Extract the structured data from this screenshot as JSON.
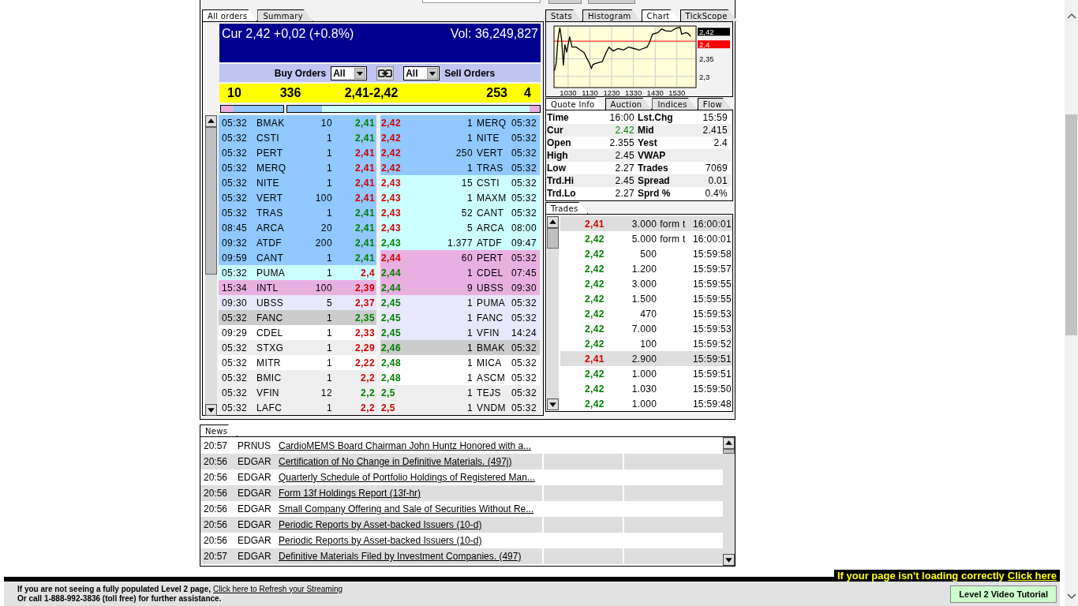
{
  "order_book": {
    "tabs": [
      {
        "label": "All orders",
        "selected": true
      },
      {
        "label": "Summary",
        "selected": false
      }
    ],
    "header": {
      "current": "Cur 2,42 +0,02 (+0.8%)",
      "volume": "Vol: 36,249,827"
    },
    "filters": {
      "buy_label": "Buy Orders",
      "buy_value": "All",
      "sell_value": "All",
      "sell_label": "Sell Orders"
    },
    "summary": [
      "10",
      "336",
      "2,41-2,42",
      "253",
      "4"
    ],
    "depth_bars": [
      {
        "color": "#90c8ff",
        "fills": [
          {
            "kind": "left",
            "color": "#e8b0e0",
            "level": 0.2
          }
        ]
      },
      {
        "color": "#ccffff",
        "fills": [
          {
            "kind": "left",
            "color": "#90c8ff",
            "level": 0.14
          },
          {
            "kind": "right",
            "color": "#e8b0e0",
            "level": 0.04
          }
        ]
      }
    ],
    "bids": [
      {
        "time": "05:32",
        "mmid": "BMAK",
        "size": "10",
        "price": "2,41",
        "up": true,
        "color": "#90c8ff"
      },
      {
        "time": "05:32",
        "mmid": "CSTI",
        "size": "1",
        "price": "2,41",
        "up": true,
        "color": "#90c8ff"
      },
      {
        "time": "05:32",
        "mmid": "PERT",
        "size": "1",
        "price": "2,41",
        "up": false,
        "color": "#90c8ff"
      },
      {
        "time": "05:32",
        "mmid": "MERQ",
        "size": "1",
        "price": "2,41",
        "up": false,
        "color": "#90c8ff"
      },
      {
        "time": "05:32",
        "mmid": "NITE",
        "size": "1",
        "price": "2,41",
        "up": false,
        "color": "#90c8ff"
      },
      {
        "time": "05:32",
        "mmid": "VERT",
        "size": "100",
        "price": "2,41",
        "up": false,
        "color": "#90c8ff"
      },
      {
        "time": "05:32",
        "mmid": "TRAS",
        "size": "1",
        "price": "2,41",
        "up": true,
        "color": "#90c8ff"
      },
      {
        "time": "08:45",
        "mmid": "ARCA",
        "size": "20",
        "price": "2,41",
        "up": true,
        "color": "#90c8ff"
      },
      {
        "time": "09:32",
        "mmid": "ATDF",
        "size": "200",
        "price": "2,41",
        "up": true,
        "color": "#90c8ff"
      },
      {
        "time": "09:59",
        "mmid": "CANT",
        "size": "1",
        "price": "2,41",
        "up": true,
        "color": "#90c8ff"
      },
      {
        "time": "05:32",
        "mmid": "PUMA",
        "size": "1",
        "price": "2,4",
        "up": false,
        "color": "#ccffff"
      },
      {
        "time": "15:34",
        "mmid": "INTL",
        "size": "100",
        "price": "2,39",
        "up": false,
        "color": "#e8b0e0"
      },
      {
        "time": "09:30",
        "mmid": "UBSS",
        "size": "5",
        "price": "2,37",
        "up": false,
        "color": "#e8e8fc"
      },
      {
        "time": "05:32",
        "mmid": "FANC",
        "size": "1",
        "price": "2,35",
        "up": true,
        "color": "#cccccc"
      },
      {
        "time": "09:29",
        "mmid": "CDEL",
        "size": "1",
        "price": "2,33",
        "up": false,
        "color": "#ffffff"
      },
      {
        "time": "05:32",
        "mmid": "STXG",
        "size": "1",
        "price": "2,29",
        "up": false,
        "color": "#eeeeee"
      },
      {
        "time": "05:32",
        "mmid": "MITR",
        "size": "1",
        "price": "2,22",
        "up": false,
        "color": "#ffffff"
      },
      {
        "time": "05:32",
        "mmid": "BMIC",
        "size": "1",
        "price": "2,2",
        "up": false,
        "color": "#eeeeee"
      },
      {
        "time": "05:32",
        "mmid": "VFIN",
        "size": "12",
        "price": "2,2",
        "up": true,
        "color": "#eeeeee"
      },
      {
        "time": "05:32",
        "mmid": "LAFC",
        "size": "1",
        "price": "2,2",
        "up": false,
        "color": "#eeeeee"
      }
    ],
    "asks": [
      {
        "price": "2,42",
        "size": "1",
        "mmid": "MERQ",
        "time": "05:32",
        "up": false,
        "color": "#90c8ff"
      },
      {
        "price": "2,42",
        "size": "1",
        "mmid": "NITE",
        "time": "05:32",
        "up": false,
        "color": "#90c8ff"
      },
      {
        "price": "2,42",
        "size": "250",
        "mmid": "VERT",
        "time": "05:32",
        "up": false,
        "color": "#90c8ff"
      },
      {
        "price": "2,42",
        "size": "1",
        "mmid": "TRAS",
        "time": "05:32",
        "up": false,
        "color": "#90c8ff"
      },
      {
        "price": "2,43",
        "size": "15",
        "mmid": "CSTI",
        "time": "05:32",
        "up": false,
        "color": "#ccffff"
      },
      {
        "price": "2,43",
        "size": "1",
        "mmid": "MAXM",
        "time": "05:32",
        "up": false,
        "color": "#ccffff"
      },
      {
        "price": "2,43",
        "size": "52",
        "mmid": "CANT",
        "time": "05:32",
        "up": false,
        "color": "#ccffff"
      },
      {
        "price": "2,43",
        "size": "5",
        "mmid": "ARCA",
        "time": "08:00",
        "up": false,
        "color": "#ccffff"
      },
      {
        "price": "2,43",
        "size": "1.377",
        "mmid": "ATDF",
        "time": "09:47",
        "up": true,
        "color": "#ccffff"
      },
      {
        "price": "2,44",
        "size": "60",
        "mmid": "PERT",
        "time": "05:32",
        "up": false,
        "color": "#e8b0e0"
      },
      {
        "price": "2,44",
        "size": "1",
        "mmid": "CDEL",
        "time": "07:45",
        "up": true,
        "color": "#e8b0e0"
      },
      {
        "price": "2,44",
        "size": "9",
        "mmid": "UBSS",
        "time": "09:30",
        "up": true,
        "color": "#e8b0e0"
      },
      {
        "price": "2,45",
        "size": "1",
        "mmid": "PUMA",
        "time": "05:32",
        "up": true,
        "color": "#e8e8fc"
      },
      {
        "price": "2,45",
        "size": "1",
        "mmid": "FANC",
        "time": "05:32",
        "up": true,
        "color": "#e8e8fc"
      },
      {
        "price": "2,45",
        "size": "1",
        "mmid": "VFIN",
        "time": "14:24",
        "up": true,
        "color": "#e8e8fc"
      },
      {
        "price": "2,46",
        "size": "1",
        "mmid": "BMAK",
        "time": "05:32",
        "up": true,
        "color": "#cccccc"
      },
      {
        "price": "2,48",
        "size": "1",
        "mmid": "MICA",
        "time": "05:32",
        "up": true,
        "color": "#ffffff"
      },
      {
        "price": "2,48",
        "size": "1",
        "mmid": "ASCM",
        "time": "05:32",
        "up": true,
        "color": "#ffffff"
      },
      {
        "price": "2,5",
        "size": "1",
        "mmid": "TEJS",
        "time": "05:32",
        "up": true,
        "color": "#eeeeee"
      },
      {
        "price": "2,5",
        "size": "1",
        "mmid": "VNDM",
        "time": "05:32",
        "up": false,
        "color": "#eeeeee"
      }
    ]
  },
  "chart_panel": {
    "tabs": [
      {
        "label": "Stats",
        "selected": false
      },
      {
        "label": "Histogram",
        "selected": false
      },
      {
        "label": "Chart",
        "selected": true
      },
      {
        "label": "TickScope",
        "selected": false
      }
    ],
    "price_markers": [
      {
        "color": "#000000"
      }
    ],
    "chart_data": {
      "type": "line",
      "x": [
        967,
        975,
        983,
        992,
        1000,
        1008,
        1015,
        1023,
        1037,
        1048,
        1067,
        1085,
        1103,
        1115,
        1127,
        1137,
        1145,
        1163,
        1187,
        1205,
        1218,
        1237,
        1260,
        1285,
        1308,
        1333,
        1357,
        1375,
        1393,
        1405,
        1418,
        1442,
        1460,
        1478,
        1503,
        1527,
        1545,
        1552,
        1570,
        1582,
        1593
      ],
      "series": [
        {
          "color": "#000000",
          "values": [
            2.316,
            2.338,
            2.405,
            2.439,
            2.405,
            2.331,
            2.39,
            2.368,
            2.413,
            2.383,
            2.383,
            2.375,
            2.368,
            2.353,
            2.338,
            2.323,
            2.334,
            2.338,
            2.342,
            2.368,
            2.383,
            2.372,
            2.379,
            2.375,
            2.383,
            2.379,
            2.375,
            2.379,
            2.383,
            2.398,
            2.42,
            2.424,
            2.435,
            2.429,
            2.428,
            2.437,
            2.439,
            2.42,
            2.424,
            2.422,
            2.413
          ]
        }
      ],
      "xlim": [
        965,
        1618
      ],
      "ylim": [
        2.268,
        2.443
      ],
      "xticks": [
        1030,
        1130,
        1230,
        1330,
        1430,
        1530
      ],
      "grid": true,
      "ref_lines": [
        {
          "axis": "y",
          "value": 2.4,
          "label": "2,4",
          "color": "#ff0000"
        }
      ],
      "yticks": [
        {
          "value": 2.3,
          "label": "2,3"
        },
        {
          "value": 2.35,
          "label": "2,35"
        },
        {
          "value": 2.42,
          "label": "2,42"
        }
      ]
    }
  },
  "quote_tabs": [
    {
      "label": "Quote Info",
      "selected": true
    },
    {
      "label": "Auction",
      "selected": false
    },
    {
      "label": "Indices",
      "selected": false
    },
    {
      "label": "Flow",
      "selected": false
    }
  ],
  "quote_info": [
    {
      "label": "Time",
      "value": "16:00",
      "up": false
    },
    {
      "label": "Lst.Chg",
      "value": "15:59",
      "up": false
    },
    {
      "label": "Cur",
      "value": "2.42",
      "up": true
    },
    {
      "label": "Mid",
      "value": "2.415",
      "up": false
    },
    {
      "label": "Open",
      "value": "2.355",
      "up": false
    },
    {
      "label": "Yest",
      "value": "2.4",
      "up": false
    },
    {
      "label": "High",
      "value": "2.45",
      "up": false
    },
    {
      "label": "VWAP"
    },
    {
      "label": "Low",
      "value": "2.27",
      "up": false
    },
    {
      "label": "Trades",
      "value": "7069",
      "up": false
    },
    {
      "label": "Trd.Hi",
      "value": "2.45",
      "up": false
    },
    {
      "label": "Spread",
      "value": "0.01",
      "up": false
    },
    {
      "label": "Trd.Lo",
      "value": "2.27",
      "up": false
    },
    {
      "label": "Sprd %",
      "value": "0.4%",
      "up": false
    }
  ],
  "trades_tab": {
    "label": "Trades",
    "selected": true
  },
  "trades": [
    {
      "price": "2,41",
      "size": "3.000",
      "condition": "form t",
      "time": "16:00:01",
      "up": false
    },
    {
      "price": "2,42",
      "size": "5.000",
      "condition": "form t",
      "time": "16:00:01",
      "up": true
    },
    {
      "price": "2,42",
      "size": "500",
      "time": "15:59:58",
      "up": true
    },
    {
      "price": "2,42",
      "size": "1.200",
      "time": "15:59:57",
      "up": true
    },
    {
      "price": "2,42",
      "size": "3.000",
      "time": "15:59:55",
      "up": true
    },
    {
      "price": "2,42",
      "size": "1.500",
      "time": "15:59:55",
      "up": true
    },
    {
      "price": "2,42",
      "size": "470",
      "time": "15:59:53",
      "up": true
    },
    {
      "price": "2,42",
      "size": "7.000",
      "time": "15:59:53",
      "up": true
    },
    {
      "price": "2,42",
      "size": "100",
      "time": "15:59:52",
      "up": true
    },
    {
      "price": "2,41",
      "size": "2.900",
      "time": "15:59:51",
      "up": false
    },
    {
      "price": "2,42",
      "size": "1.000",
      "time": "15:59:51",
      "up": true
    },
    {
      "price": "2,42",
      "size": "1.030",
      "time": "15:59:50",
      "up": true
    },
    {
      "price": "2,42",
      "size": "1.000",
      "time": "15:59:48",
      "up": true
    }
  ],
  "news_tab": {
    "label": "News",
    "selected": true
  },
  "news": [
    {
      "time": "20:57",
      "source": "PRNUS",
      "headline": "CardioMEMS Board Chairman John Huntz Honored with a..."
    },
    {
      "time": "20:56",
      "source": "EDGAR",
      "headline": "Certification of No Change in Definitive Materials. (497j)"
    },
    {
      "time": "20:56",
      "source": "EDGAR",
      "headline": "Quarterly Schedule of Portfolio Holdings of Registered Man..."
    },
    {
      "time": "20:56",
      "source": "EDGAR",
      "headline": "Form 13f Holdings Report (13f-hr)"
    },
    {
      "time": "20:56",
      "source": "EDGAR",
      "headline": "Small Company Offering and Sale of Securities Without Re..."
    },
    {
      "time": "20:56",
      "source": "EDGAR",
      "headline": "Periodic Reports by Asset-backed Issuers (10-d)"
    },
    {
      "time": "20:56",
      "source": "EDGAR",
      "headline": "Periodic Reports by Asset-backed Issuers (10-d)"
    },
    {
      "time": "20:57",
      "source": "EDGAR",
      "headline": "Definitive Materials Filed by Investment Companies. (497)"
    }
  ],
  "footer": {
    "alert": "If your page isn't loading correctly",
    "alert_link": "Click here",
    "message": "If you are not seeing a fully populated Level 2 page,",
    "refresh_link": "Click here to Refresh your Streaming",
    "call": "Or call 1-888-992-3836 (toll free) for further assistance.",
    "button": "Level 2 Video Tutorial"
  }
}
